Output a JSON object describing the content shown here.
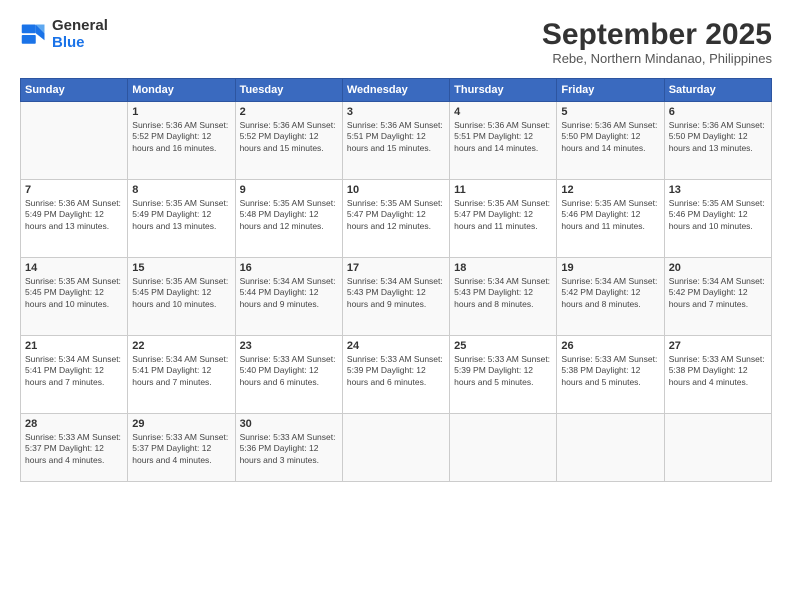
{
  "logo": {
    "line1": "General",
    "line2": "Blue"
  },
  "title": "September 2025",
  "subtitle": "Rebe, Northern Mindanao, Philippines",
  "weekdays": [
    "Sunday",
    "Monday",
    "Tuesday",
    "Wednesday",
    "Thursday",
    "Friday",
    "Saturday"
  ],
  "rows": [
    [
      {
        "day": "",
        "info": ""
      },
      {
        "day": "1",
        "info": "Sunrise: 5:36 AM\nSunset: 5:52 PM\nDaylight: 12 hours\nand 16 minutes."
      },
      {
        "day": "2",
        "info": "Sunrise: 5:36 AM\nSunset: 5:52 PM\nDaylight: 12 hours\nand 15 minutes."
      },
      {
        "day": "3",
        "info": "Sunrise: 5:36 AM\nSunset: 5:51 PM\nDaylight: 12 hours\nand 15 minutes."
      },
      {
        "day": "4",
        "info": "Sunrise: 5:36 AM\nSunset: 5:51 PM\nDaylight: 12 hours\nand 14 minutes."
      },
      {
        "day": "5",
        "info": "Sunrise: 5:36 AM\nSunset: 5:50 PM\nDaylight: 12 hours\nand 14 minutes."
      },
      {
        "day": "6",
        "info": "Sunrise: 5:36 AM\nSunset: 5:50 PM\nDaylight: 12 hours\nand 13 minutes."
      }
    ],
    [
      {
        "day": "7",
        "info": "Sunrise: 5:36 AM\nSunset: 5:49 PM\nDaylight: 12 hours\nand 13 minutes."
      },
      {
        "day": "8",
        "info": "Sunrise: 5:35 AM\nSunset: 5:49 PM\nDaylight: 12 hours\nand 13 minutes."
      },
      {
        "day": "9",
        "info": "Sunrise: 5:35 AM\nSunset: 5:48 PM\nDaylight: 12 hours\nand 12 minutes."
      },
      {
        "day": "10",
        "info": "Sunrise: 5:35 AM\nSunset: 5:47 PM\nDaylight: 12 hours\nand 12 minutes."
      },
      {
        "day": "11",
        "info": "Sunrise: 5:35 AM\nSunset: 5:47 PM\nDaylight: 12 hours\nand 11 minutes."
      },
      {
        "day": "12",
        "info": "Sunrise: 5:35 AM\nSunset: 5:46 PM\nDaylight: 12 hours\nand 11 minutes."
      },
      {
        "day": "13",
        "info": "Sunrise: 5:35 AM\nSunset: 5:46 PM\nDaylight: 12 hours\nand 10 minutes."
      }
    ],
    [
      {
        "day": "14",
        "info": "Sunrise: 5:35 AM\nSunset: 5:45 PM\nDaylight: 12 hours\nand 10 minutes."
      },
      {
        "day": "15",
        "info": "Sunrise: 5:35 AM\nSunset: 5:45 PM\nDaylight: 12 hours\nand 10 minutes."
      },
      {
        "day": "16",
        "info": "Sunrise: 5:34 AM\nSunset: 5:44 PM\nDaylight: 12 hours\nand 9 minutes."
      },
      {
        "day": "17",
        "info": "Sunrise: 5:34 AM\nSunset: 5:43 PM\nDaylight: 12 hours\nand 9 minutes."
      },
      {
        "day": "18",
        "info": "Sunrise: 5:34 AM\nSunset: 5:43 PM\nDaylight: 12 hours\nand 8 minutes."
      },
      {
        "day": "19",
        "info": "Sunrise: 5:34 AM\nSunset: 5:42 PM\nDaylight: 12 hours\nand 8 minutes."
      },
      {
        "day": "20",
        "info": "Sunrise: 5:34 AM\nSunset: 5:42 PM\nDaylight: 12 hours\nand 7 minutes."
      }
    ],
    [
      {
        "day": "21",
        "info": "Sunrise: 5:34 AM\nSunset: 5:41 PM\nDaylight: 12 hours\nand 7 minutes."
      },
      {
        "day": "22",
        "info": "Sunrise: 5:34 AM\nSunset: 5:41 PM\nDaylight: 12 hours\nand 7 minutes."
      },
      {
        "day": "23",
        "info": "Sunrise: 5:33 AM\nSunset: 5:40 PM\nDaylight: 12 hours\nand 6 minutes."
      },
      {
        "day": "24",
        "info": "Sunrise: 5:33 AM\nSunset: 5:39 PM\nDaylight: 12 hours\nand 6 minutes."
      },
      {
        "day": "25",
        "info": "Sunrise: 5:33 AM\nSunset: 5:39 PM\nDaylight: 12 hours\nand 5 minutes."
      },
      {
        "day": "26",
        "info": "Sunrise: 5:33 AM\nSunset: 5:38 PM\nDaylight: 12 hours\nand 5 minutes."
      },
      {
        "day": "27",
        "info": "Sunrise: 5:33 AM\nSunset: 5:38 PM\nDaylight: 12 hours\nand 4 minutes."
      }
    ],
    [
      {
        "day": "28",
        "info": "Sunrise: 5:33 AM\nSunset: 5:37 PM\nDaylight: 12 hours\nand 4 minutes."
      },
      {
        "day": "29",
        "info": "Sunrise: 5:33 AM\nSunset: 5:37 PM\nDaylight: 12 hours\nand 4 minutes."
      },
      {
        "day": "30",
        "info": "Sunrise: 5:33 AM\nSunset: 5:36 PM\nDaylight: 12 hours\nand 3 minutes."
      },
      {
        "day": "",
        "info": ""
      },
      {
        "day": "",
        "info": ""
      },
      {
        "day": "",
        "info": ""
      },
      {
        "day": "",
        "info": ""
      }
    ]
  ]
}
